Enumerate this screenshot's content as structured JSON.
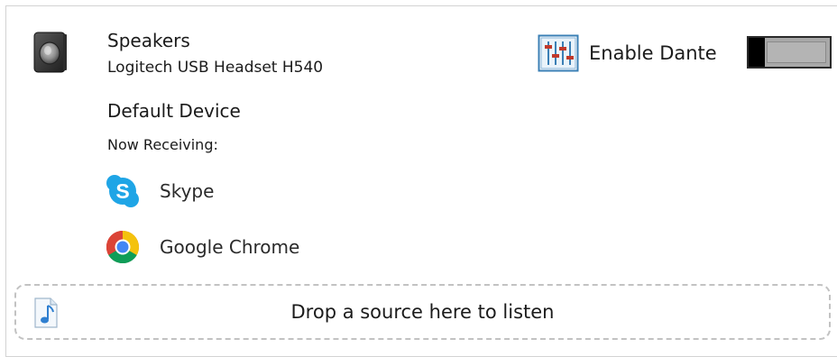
{
  "device": {
    "icon": "speaker-icon",
    "name": "Speakers",
    "subtitle": "Logitech USB Headset H540",
    "status": "Default Device"
  },
  "dante": {
    "icon": "mixer-sliders-icon",
    "label": "Enable Dante",
    "enabled": false,
    "accent_color": "#3a7fb5"
  },
  "receiving": {
    "heading": "Now Receiving:",
    "sources": [
      {
        "name": "Skype",
        "icon": "skype-icon",
        "color": "#1fa5e6"
      },
      {
        "name": "Google Chrome",
        "icon": "chrome-icon",
        "color": "#db4437"
      }
    ]
  },
  "dropzone": {
    "icon": "music-note-icon",
    "text": "Drop a source here to listen"
  }
}
